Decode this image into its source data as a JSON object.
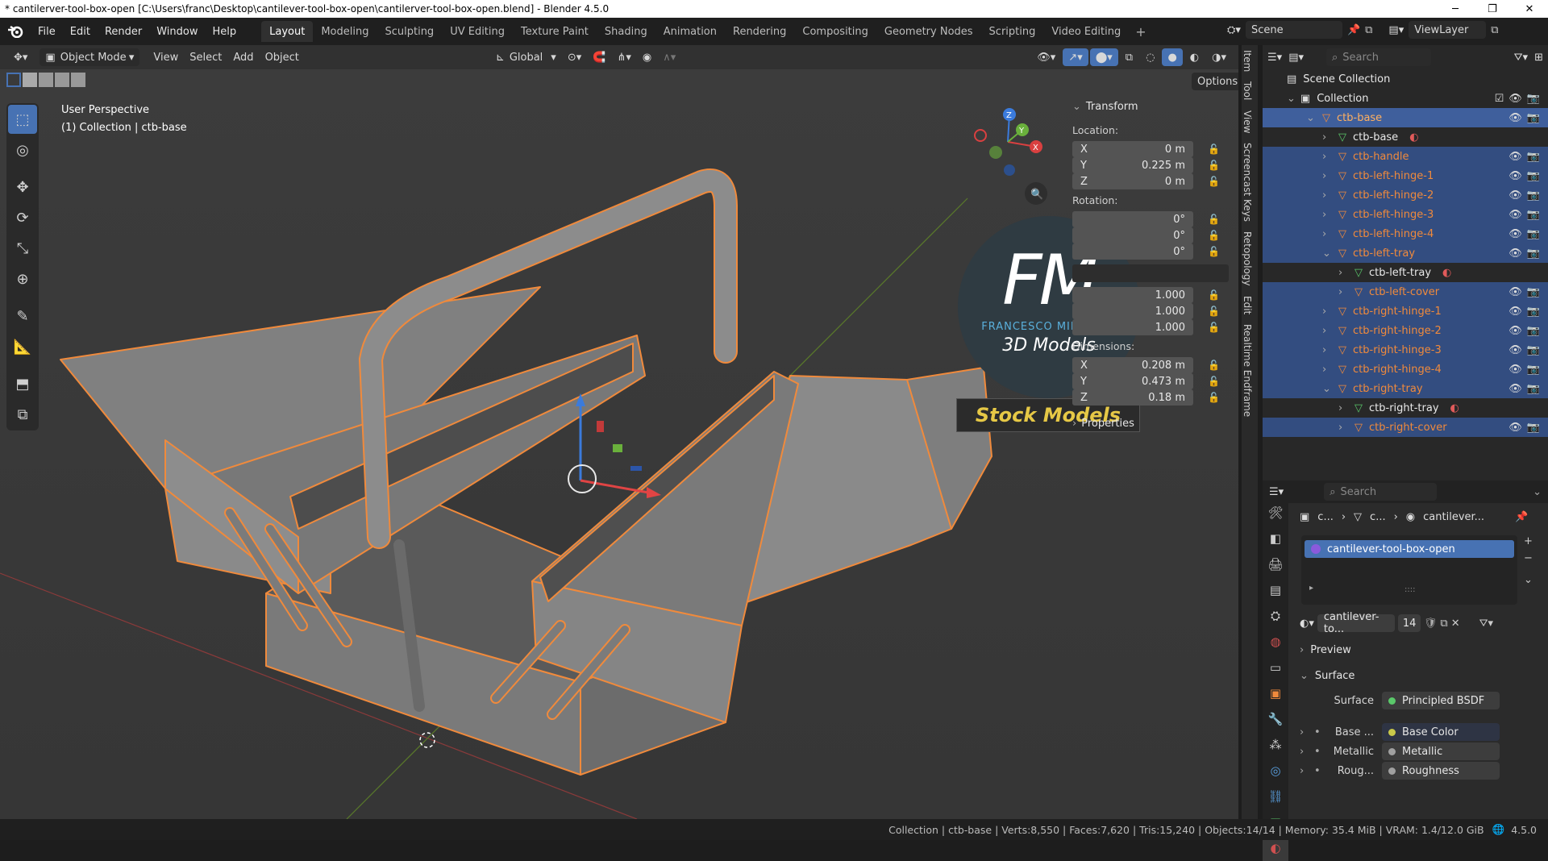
{
  "window": {
    "title": "* cantilerver-tool-box-open [C:\\Users\\franc\\Desktop\\cantilever-tool-box-open\\cantilerver-tool-box-open.blend] - Blender 4.5.0"
  },
  "menubar": {
    "items": [
      "File",
      "Edit",
      "Render",
      "Window",
      "Help"
    ]
  },
  "workspaces": [
    "Layout",
    "Modeling",
    "Sculpting",
    "UV Editing",
    "Texture Paint",
    "Shading",
    "Animation",
    "Rendering",
    "Compositing",
    "Geometry Nodes",
    "Scripting",
    "Video Editing"
  ],
  "scene": {
    "scene_name": "Scene",
    "view_layer": "ViewLayer"
  },
  "viewport_header": {
    "mode": "Object Mode",
    "menus": [
      "View",
      "Select",
      "Add",
      "Object"
    ],
    "orientation": "Global",
    "options_label": "Options"
  },
  "viewport": {
    "perspective": "User Perspective",
    "active": "(1) Collection | ctb-base"
  },
  "npanel": {
    "transform_title": "Transform",
    "location_label": "Location:",
    "location": [
      {
        "axis": "X",
        "value": "0 m"
      },
      {
        "axis": "Y",
        "value": "0.225 m"
      },
      {
        "axis": "Z",
        "value": "0 m"
      }
    ],
    "rotation_label": "Rotation:",
    "rotation": [
      "0°",
      "0°",
      "0°"
    ],
    "scale": [
      "1.000",
      "1.000",
      "1.000"
    ],
    "dimensions_label": "Dimensions:",
    "dimensions": [
      {
        "axis": "X",
        "value": "0.208 m"
      },
      {
        "axis": "Y",
        "value": "0.473 m"
      },
      {
        "axis": "Z",
        "value": "0.18 m"
      }
    ],
    "properties_label": "Properties"
  },
  "side_tabs": [
    "Item",
    "Tool",
    "View",
    "Screencast Keys",
    "Retopology",
    "Edit",
    "Realtime Endframe"
  ],
  "watermark": {
    "initials": "FM",
    "brand": "FRANCESCO MILANESE",
    "subtitle": "3D Models",
    "banner": "Stock Models"
  },
  "outliner": {
    "search_placeholder": "Search",
    "scene_collection": "Scene Collection",
    "collection": "Collection",
    "rows": [
      {
        "name": "ctb-base",
        "indent": 2,
        "type": "object",
        "state": "active"
      },
      {
        "name": "ctb-base",
        "indent": 3,
        "type": "mesh",
        "state": "plain"
      },
      {
        "name": "ctb-handle",
        "indent": 3,
        "type": "object",
        "state": "sel"
      },
      {
        "name": "ctb-left-hinge-1",
        "indent": 3,
        "type": "object",
        "state": "sel"
      },
      {
        "name": "ctb-left-hinge-2",
        "indent": 3,
        "type": "object",
        "state": "sel"
      },
      {
        "name": "ctb-left-hinge-3",
        "indent": 3,
        "type": "object",
        "state": "sel"
      },
      {
        "name": "ctb-left-hinge-4",
        "indent": 3,
        "type": "object",
        "state": "sel"
      },
      {
        "name": "ctb-left-tray",
        "indent": 3,
        "type": "object",
        "state": "sel"
      },
      {
        "name": "ctb-left-tray",
        "indent": 4,
        "type": "mesh",
        "state": "plain"
      },
      {
        "name": "ctb-left-cover",
        "indent": 4,
        "type": "object",
        "state": "sel"
      },
      {
        "name": "ctb-right-hinge-1",
        "indent": 3,
        "type": "object",
        "state": "sel"
      },
      {
        "name": "ctb-right-hinge-2",
        "indent": 3,
        "type": "object",
        "state": "sel"
      },
      {
        "name": "ctb-right-hinge-3",
        "indent": 3,
        "type": "object",
        "state": "sel"
      },
      {
        "name": "ctb-right-hinge-4",
        "indent": 3,
        "type": "object",
        "state": "sel"
      },
      {
        "name": "ctb-right-tray",
        "indent": 3,
        "type": "object",
        "state": "sel"
      },
      {
        "name": "ctb-right-tray",
        "indent": 4,
        "type": "mesh",
        "state": "plain"
      },
      {
        "name": "ctb-right-cover",
        "indent": 4,
        "type": "object",
        "state": "sel"
      }
    ]
  },
  "properties": {
    "search_placeholder": "Search",
    "breadcrumb": [
      "c...",
      "c...",
      "cantilever..."
    ],
    "material_slot": "cantilever-tool-box-open",
    "material_name": "cantilever-to...",
    "user_count": "14",
    "preview_label": "Preview",
    "surface_label": "Surface",
    "surface_field_label": "Surface",
    "surface_shader": "Principled BSDF",
    "inputs": [
      {
        "label": "Base ...",
        "value": "Base Color",
        "dot": "#c8c84a"
      },
      {
        "label": "Metallic",
        "value": "Metallic",
        "dot": "#a0a0a0"
      },
      {
        "label": "Roug...",
        "value": "Roughness",
        "dot": "#a0a0a0"
      }
    ]
  },
  "statusbar": {
    "text": "Collection | ctb-base | Verts:8,550 | Faces:7,620 | Tris:15,240 | Objects:14/14 | Memory: 35.4 MiB | VRAM: 1.4/12.0 GiB",
    "version": "4.5.0"
  },
  "colors": {
    "selection": "#334d80",
    "accent": "#4772b3",
    "outline_orange": "#f08a3c",
    "viewport_bg": "#3a3a3a"
  }
}
